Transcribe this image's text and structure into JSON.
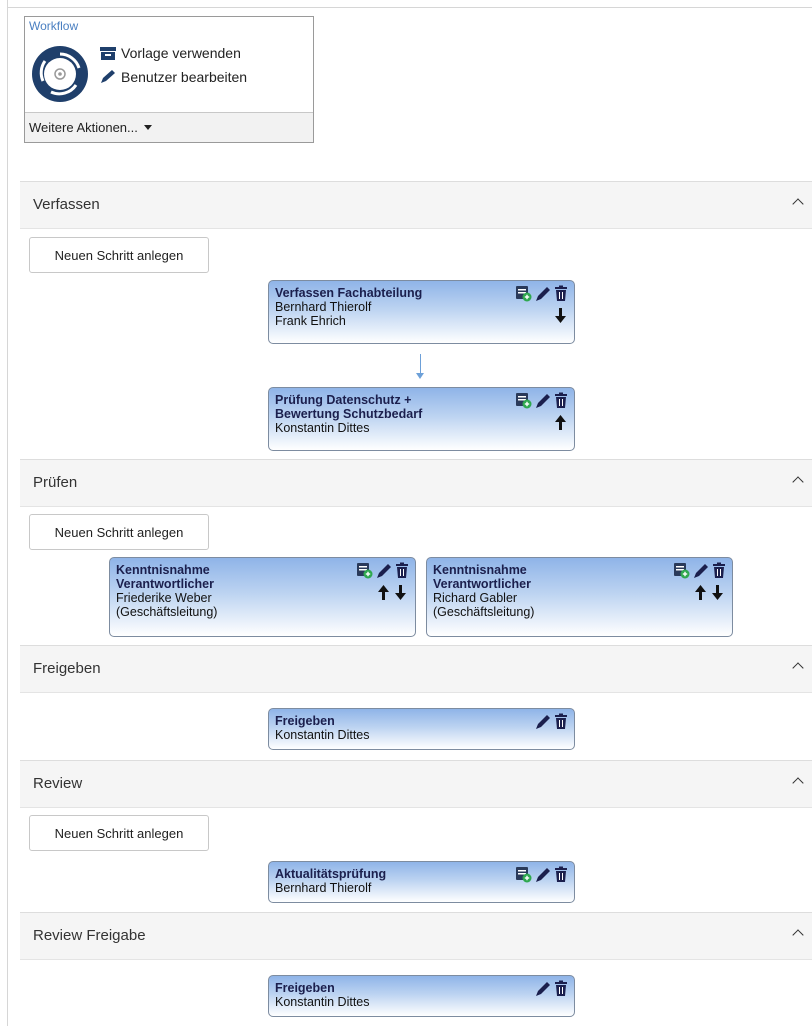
{
  "workflow": {
    "title": "Workflow",
    "action_template": "Vorlage verwenden",
    "action_users": "Benutzer bearbeiten",
    "more_actions": "Weitere Aktionen..."
  },
  "new_step_label": "Neuen Schritt anlegen",
  "sections": [
    {
      "title": "Verfassen",
      "steps": [
        {
          "title": "Verfassen Fachabteilung",
          "lines": [
            "Bernhard Thierolf",
            "Frank Ehrich"
          ]
        },
        {
          "title_lines": [
            "Prüfung Datenschutz +",
            "Bewertung Schutzbedarf"
          ],
          "lines": [
            "Konstantin Dittes"
          ]
        }
      ]
    },
    {
      "title": "Prüfen",
      "steps": [
        {
          "title_lines": [
            "Kenntnisnahme",
            "Verantwortlicher"
          ],
          "lines": [
            "Friederike Weber",
            "(Geschäftsleitung)"
          ]
        },
        {
          "title_lines": [
            "Kenntnisnahme",
            "Verantwortlicher"
          ],
          "lines": [
            "Richard Gabler",
            "(Geschäftsleitung)"
          ]
        }
      ]
    },
    {
      "title": "Freigeben",
      "steps": [
        {
          "title": "Freigeben",
          "lines": [
            "Konstantin Dittes"
          ]
        }
      ]
    },
    {
      "title": "Review",
      "steps": [
        {
          "title": "Aktualitätsprüfung",
          "lines": [
            "Bernhard Thierolf"
          ]
        }
      ]
    },
    {
      "title": "Review Freigabe",
      "steps": [
        {
          "title": "Freigeben",
          "lines": [
            "Konstantin Dittes"
          ]
        }
      ]
    }
  ],
  "colors": {
    "accent": "#4a7fc1",
    "card_top": "#8fb4e8",
    "logo_dark": "#1f3f6b"
  }
}
